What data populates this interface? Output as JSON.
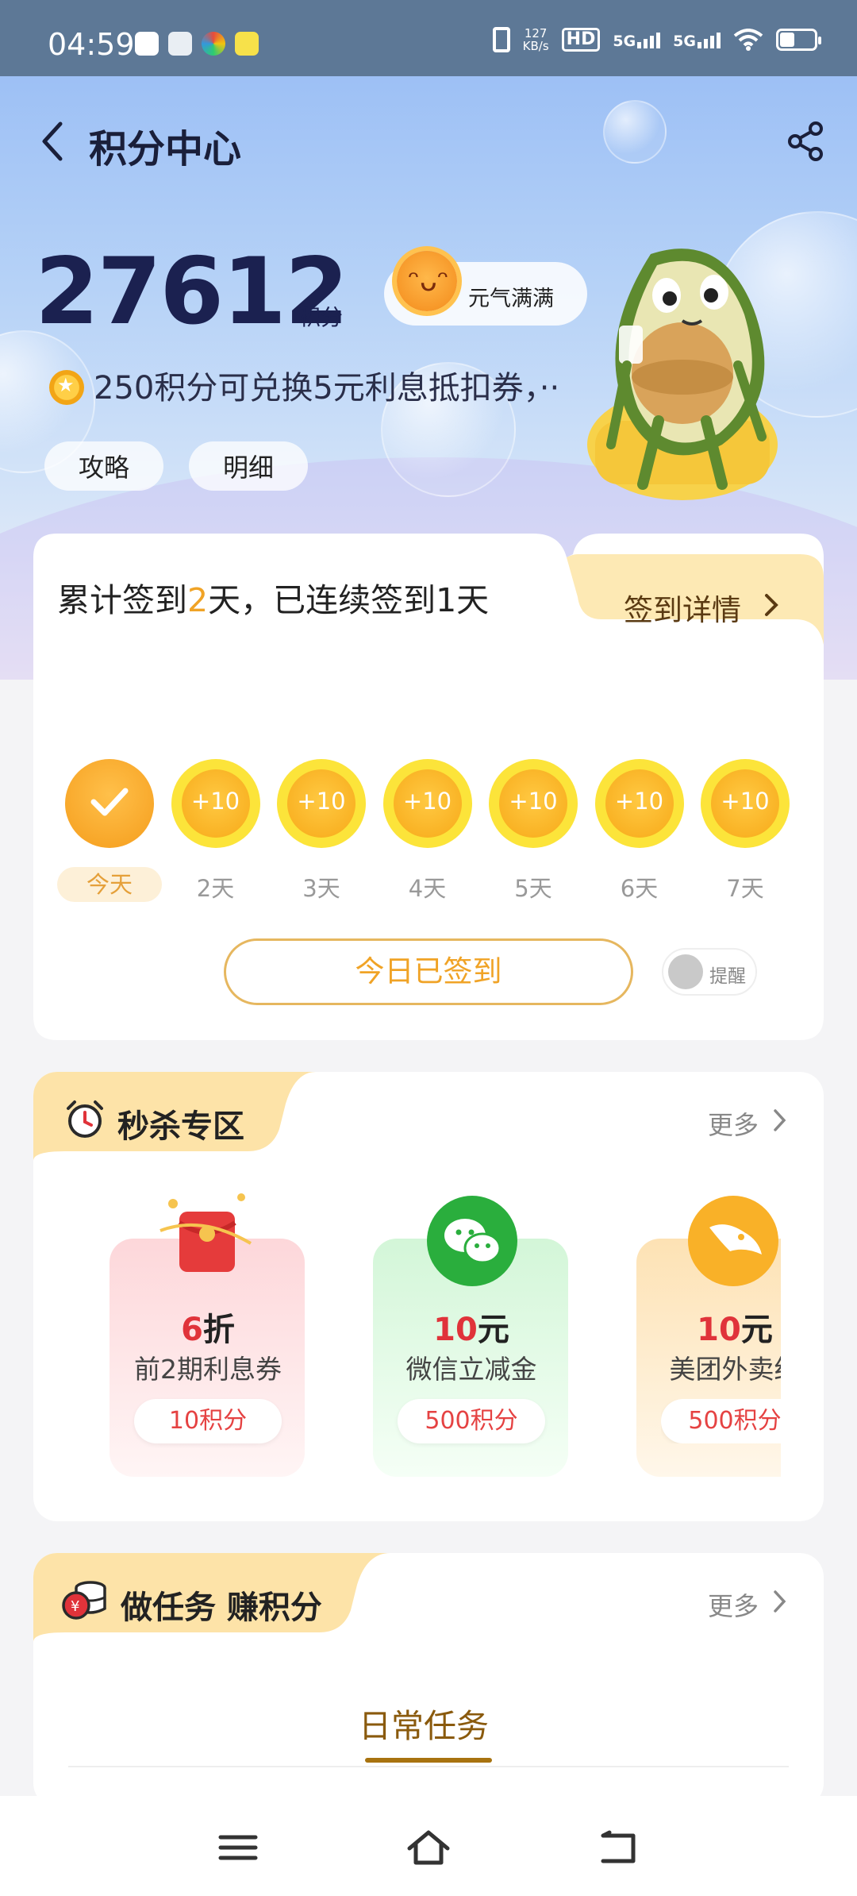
{
  "status_bar": {
    "time": "04:59",
    "net_speed": "127\nKB/s",
    "hd": "HD",
    "sim1": "5G",
    "sim2": "5G",
    "icons": [
      "notification-app-icon",
      "wechat-icon",
      "app-icon",
      "app-icon",
      "vibrate-icon",
      "hd-icon",
      "signal-icon",
      "signal-icon",
      "wifi-icon",
      "battery-icon"
    ]
  },
  "header": {
    "title": "积分中心",
    "back_icon": "chevron-left-icon",
    "share_icon": "share-icon"
  },
  "points": {
    "value": "27612",
    "unit": "积分",
    "mood_text": "元气满满",
    "tip": "250积分可兑换5元利息抵扣券，··"
  },
  "quick_links": [
    "攻略",
    "明细"
  ],
  "signin": {
    "text_prefix": "累计签到",
    "total_days": "2",
    "text_suffix": "天，已连续签到1天",
    "detail_label": "签到详情",
    "days": [
      {
        "label": "今天",
        "value": "",
        "checked": true
      },
      {
        "label": "2天",
        "value": "+10",
        "checked": false
      },
      {
        "label": "3天",
        "value": "+10",
        "checked": false
      },
      {
        "label": "4天",
        "value": "+10",
        "checked": false
      },
      {
        "label": "5天",
        "value": "+10",
        "checked": false
      },
      {
        "label": "6天",
        "value": "+10",
        "checked": false
      },
      {
        "label": "7天",
        "value": "+10",
        "checked": false
      }
    ],
    "button_label": "今日已签到",
    "remind_label": "提醒"
  },
  "seckill": {
    "title": "秒杀专区",
    "more_label": "更多",
    "deals": [
      {
        "value": "6",
        "unit": "折",
        "name": "前2期利息券",
        "cost": "10积分",
        "color": "#fde3e4"
      },
      {
        "value": "10",
        "unit": "元",
        "name": "微信立减金",
        "cost": "500积分",
        "color": "#e2f8e4"
      },
      {
        "value": "10",
        "unit": "元",
        "name": "美团外卖红",
        "cost": "500积分",
        "color": "#fdeed6"
      }
    ]
  },
  "tasks": {
    "title": "做任务 赚积分",
    "more_label": "更多",
    "tab_label": "日常任务"
  },
  "navbar": {
    "icons": [
      "menu-icon",
      "home-icon",
      "back-icon"
    ]
  },
  "colors": {
    "accent": "#f0a326",
    "price": "#e0333a",
    "status_bar": "#5d7896"
  }
}
